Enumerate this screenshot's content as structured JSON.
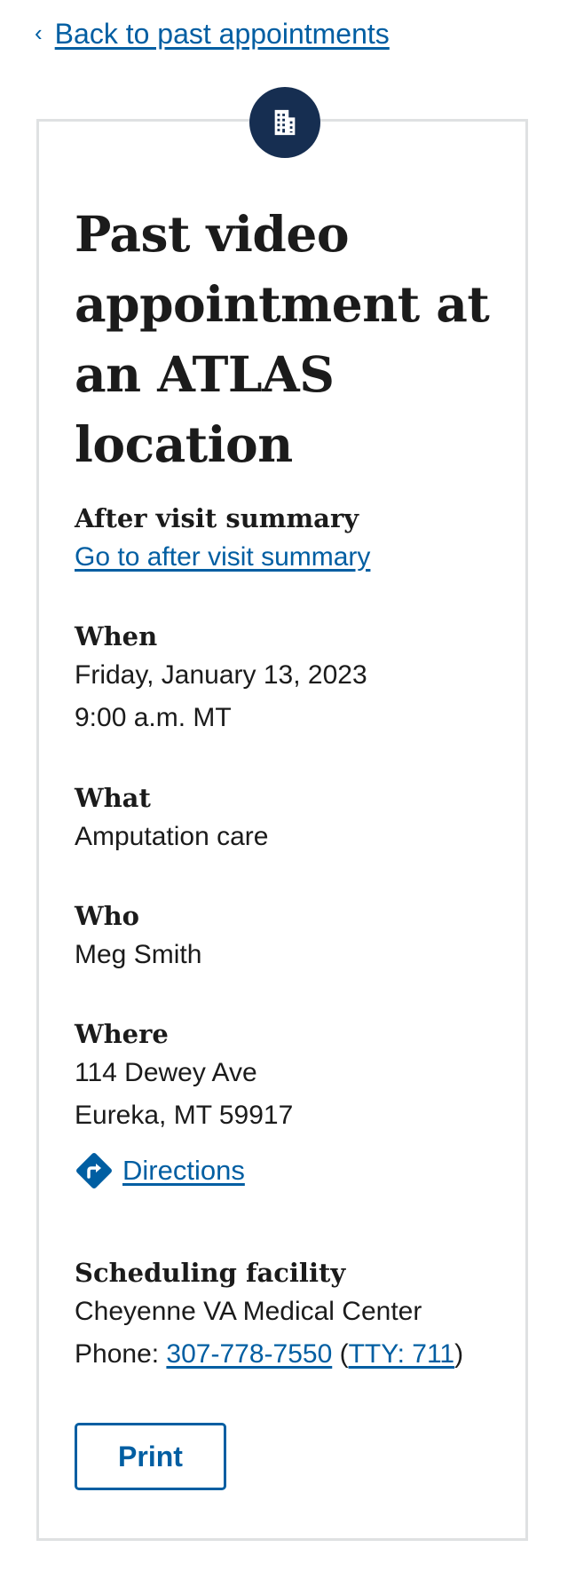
{
  "back_link": {
    "label": "Back to past appointments",
    "chevron": "‹"
  },
  "header": {
    "icon": "building-icon",
    "title": "Past video appointment at an ATLAS location"
  },
  "after_visit": {
    "heading": "After visit summary",
    "link": "Go to after visit summary"
  },
  "when": {
    "heading": "When",
    "date": "Friday, January 13, 2023",
    "time": "9:00 a.m. MT"
  },
  "what": {
    "heading": "What",
    "value": "Amputation care"
  },
  "who": {
    "heading": "Who",
    "value": "Meg Smith"
  },
  "where": {
    "heading": "Where",
    "address_line1": "114 Dewey Ave",
    "address_line2": "Eureka, MT 59917",
    "directions_icon": "directions-icon",
    "directions_link": "Directions"
  },
  "facility": {
    "heading": "Scheduling facility",
    "name": "Cheyenne VA Medical Center",
    "phone_label": "Phone: ",
    "phone": "307-778-7550",
    "open_paren": " (",
    "tty": "TTY: 711",
    "close_paren": ")"
  },
  "actions": {
    "print_label": "Print"
  },
  "colors": {
    "link": "#005ea2",
    "badge": "#162e51",
    "border": "#dfe1e2",
    "text": "#1b1b1b"
  }
}
